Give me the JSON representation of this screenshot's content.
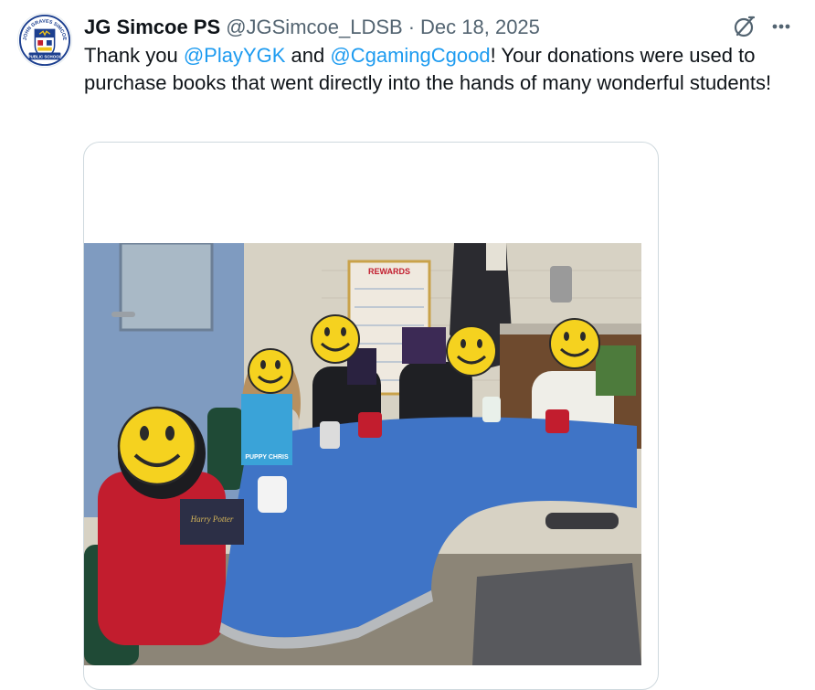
{
  "tweet": {
    "author": {
      "display_name": "JG Simcoe PS",
      "handle": "@JGSimcoe_LDSB",
      "avatar": {
        "icon": "school-crest-logo",
        "arc_text": "JOHN GRAVES SIMCOE",
        "banner_text": "PUBLIC SCHOOL"
      }
    },
    "separator": "·",
    "date": "Dec 18, 2025",
    "text": {
      "part1": "Thank you ",
      "mention1": "@PlayYGK",
      "part2": " and ",
      "mention2": "@CgamingCgood",
      "part3": "! Your donations were used to purchase books that went directly into the hands of many wonderful students!"
    },
    "actions": {
      "grok_icon": "grok-icon",
      "more_icon": "more-icon"
    },
    "media": {
      "type": "photo",
      "book_cover_texts": [
        "Harry Potter",
        "PUPPY CHRIS",
        "REWARDS"
      ]
    }
  },
  "colors": {
    "link": "#1d9bf0",
    "muted": "#536471",
    "text": "#0f1419",
    "border": "#cfd9de",
    "table": "#3f74c6",
    "smiley": "#f5d21f"
  }
}
